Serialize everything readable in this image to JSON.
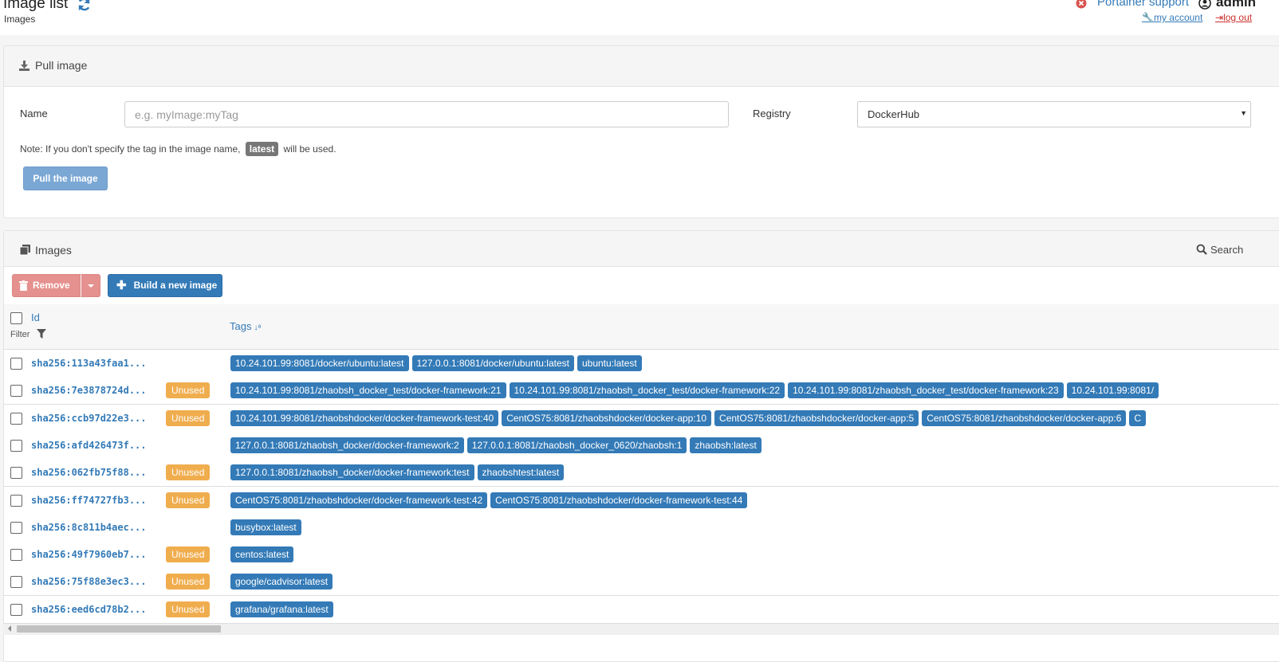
{
  "header": {
    "title": "Image list",
    "breadcrumb": "Images",
    "support_label": "Portainer support",
    "username": "admin",
    "my_account_label": "my account",
    "logout_label": "log out"
  },
  "pull": {
    "title": "Pull image",
    "name_label": "Name",
    "name_placeholder": "e.g. myImage:myTag",
    "registry_label": "Registry",
    "registry_value": "DockerHub",
    "note_before": "Note: If you don't specify the tag in the image name,",
    "note_tag": "latest",
    "note_after": "will be used.",
    "button_label": "Pull the image"
  },
  "images": {
    "title": "Images",
    "search_label": "Search",
    "remove_label": "Remove",
    "build_label": "Build a new image",
    "col_id": "Id",
    "col_filter": "Filter",
    "col_tags": "Tags",
    "unused_label": "Unused",
    "rows": [
      {
        "id": "sha256:113a43faa1...",
        "unused": false,
        "tags": [
          "10.24.101.99:8081/docker/ubuntu:latest",
          "127.0.0.1:8081/docker/ubuntu:latest",
          "ubuntu:latest"
        ]
      },
      {
        "id": "sha256:7e3878724d...",
        "unused": true,
        "tags": [
          "10.24.101.99:8081/zhaobsh_docker_test/docker-framework:21",
          "10.24.101.99:8081/zhaobsh_docker_test/docker-framework:22",
          "10.24.101.99:8081/zhaobsh_docker_test/docker-framework:23",
          "10.24.101.99:8081/"
        ]
      },
      {
        "id": "sha256:ccb97d22e3...",
        "unused": true,
        "tags": [
          "10.24.101.99:8081/zhaobshdocker/docker-framework-test:40",
          "CentOS75:8081/zhaobshdocker/docker-app:10",
          "CentOS75:8081/zhaobshdocker/docker-app:5",
          "CentOS75:8081/zhaobshdocker/docker-app:6",
          "C"
        ]
      },
      {
        "id": "sha256:afd426473f...",
        "unused": false,
        "tags": [
          "127.0.0.1:8081/zhaobsh_docker/docker-framework:2",
          "127.0.0.1:8081/zhaobsh_docker_0620/zhaobsh:1",
          "zhaobsh:latest"
        ]
      },
      {
        "id": "sha256:062fb75f88...",
        "unused": true,
        "tags": [
          "127.0.0.1:8081/zhaobsh_docker/docker-framework:test",
          "zhaobshtest:latest"
        ]
      },
      {
        "id": "sha256:ff74727fb3...",
        "unused": true,
        "tags": [
          "CentOS75:8081/zhaobshdocker/docker-framework-test:42",
          "CentOS75:8081/zhaobshdocker/docker-framework-test:44"
        ]
      },
      {
        "id": "sha256:8c811b4aec...",
        "unused": false,
        "tags": [
          "busybox:latest"
        ]
      },
      {
        "id": "sha256:49f7960eb7...",
        "unused": true,
        "tags": [
          "centos:latest"
        ]
      },
      {
        "id": "sha256:75f88e3ec3...",
        "unused": true,
        "tags": [
          "google/cadvisor:latest"
        ]
      },
      {
        "id": "sha256:eed6cd78b2...",
        "unused": true,
        "tags": [
          "grafana/grafana:latest"
        ]
      }
    ]
  },
  "colors": {
    "primary": "#337ab7",
    "warning": "#f0ad4e",
    "danger_light": "#e5918f"
  }
}
